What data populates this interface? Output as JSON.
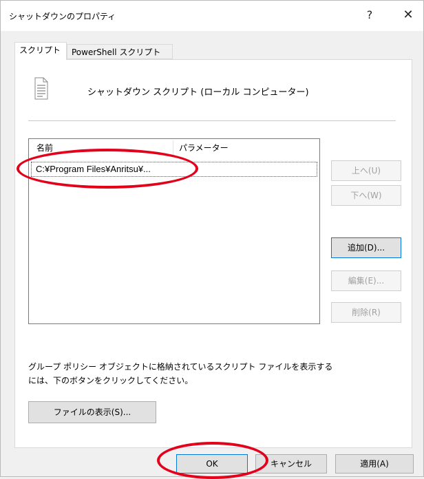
{
  "window": {
    "title": "シャットダウンのプロパティ",
    "help_glyph": "?",
    "close_glyph": "✕"
  },
  "tabs": [
    {
      "label": "スクリプト",
      "active": true
    },
    {
      "label": "PowerShell スクリプト",
      "active": false
    }
  ],
  "header": {
    "icon": "script-icon",
    "text": "シャットダウン スクリプト (ローカル コンピューター)"
  },
  "list": {
    "columns": [
      "名前",
      "パラメーター"
    ],
    "rows": [
      {
        "name": "C:¥Program Files¥Anritsu¥...",
        "params": ""
      }
    ]
  },
  "side_buttons": {
    "up_label": "上へ(U)",
    "down_label": "下へ(W)",
    "add_label": "追加(D)...",
    "edit_label": "編集(E)...",
    "delete_label": "削除(R)"
  },
  "info": {
    "line1": "グループ ポリシー オブジェクトに格納されているスクリプト ファイルを表示する",
    "line2": "には、下のボタンをクリックしてください。"
  },
  "show_files_label": "ファイルの表示(S)...",
  "footer": {
    "ok_label": "OK",
    "cancel_label": "キャンセル",
    "apply_label": "適用(A)"
  },
  "colors": {
    "annotation": "#e3001b",
    "focus_border": "#0078d7"
  }
}
